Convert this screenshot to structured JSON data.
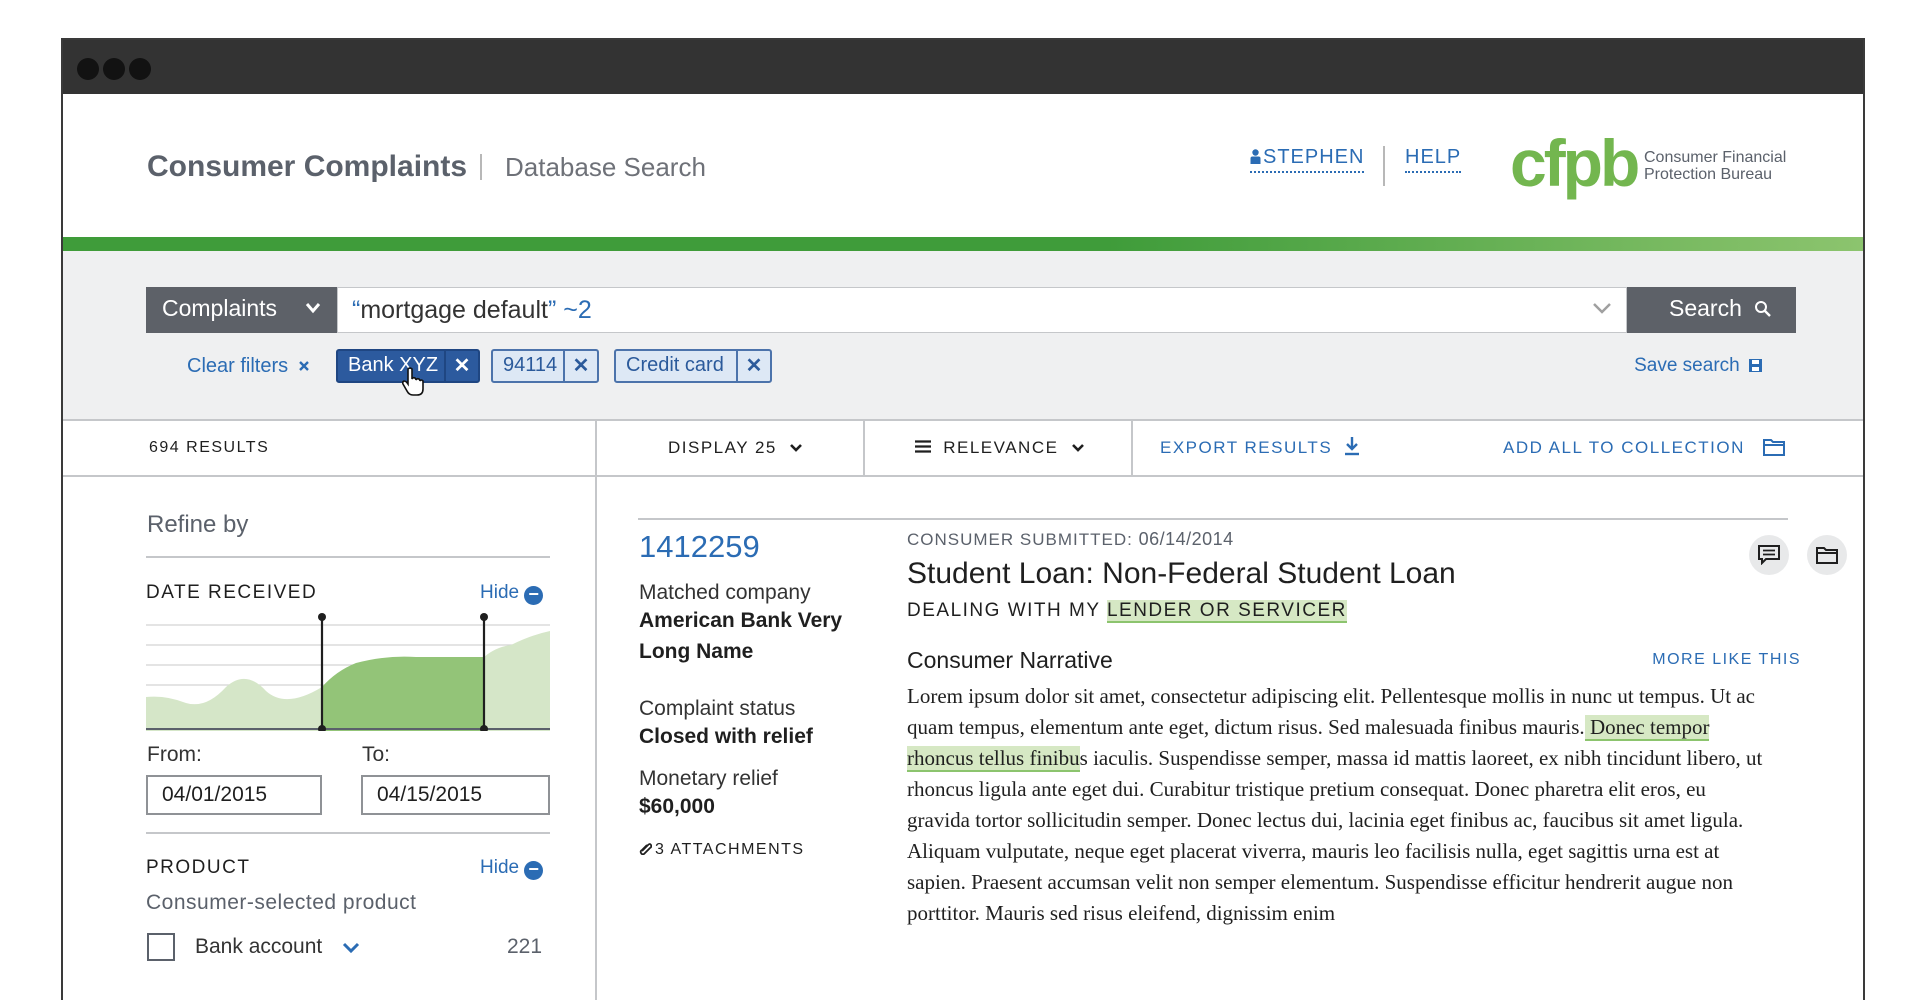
{
  "header": {
    "title": "Consumer Complaints",
    "subtitle": "Database Search",
    "user_label": "STEPHEN",
    "help_label": "HELP",
    "logo_mark": "cfpb",
    "logo_line1": "Consumer Financial",
    "logo_line2": "Protection Bureau"
  },
  "search": {
    "type_label": "Complaints",
    "query_quoted": "“mortgage default”",
    "query_suffix": " ~2",
    "button_label": "Search",
    "clear_filters_label": "Clear filters",
    "filters": [
      "Bank XYZ",
      "94114",
      "Credit card"
    ],
    "save_search_label": "Save search"
  },
  "results_bar": {
    "count_label": "694 RESULTS",
    "display_label": "DISPLAY 25",
    "sort_label": "RELEVANCE",
    "export_label": "EXPORT RESULTS",
    "add_all_label": "ADD ALL TO COLLECTION"
  },
  "refine": {
    "title": "Refine by",
    "date_section": {
      "title": "DATE RECEIVED",
      "hide_label": "Hide",
      "from_label": "From:",
      "to_label": "To:",
      "from_value": "04/01/2015",
      "to_value": "04/15/2015"
    },
    "product_section": {
      "title": "PRODUCT",
      "hide_label": "Hide",
      "subtitle": "Consumer-selected product",
      "items": [
        {
          "label": "Bank account",
          "count": "221"
        }
      ]
    }
  },
  "complaint": {
    "id": "1412259",
    "company_label": "Matched company",
    "company_value": "American Bank Very Long Name",
    "status_label": "Complaint status",
    "status_value": "Closed with relief",
    "relief_label": "Monetary relief",
    "relief_value": "$60,000",
    "attachments_label": "3 ATTACHMENTS",
    "submitted_label": "CONSUMER SUBMITTED:",
    "submitted_date": "06/14/2014",
    "title": "Student Loan: Non-Federal Student Loan",
    "issue_prefix": "DEALING WITH MY",
    "issue_highlight": "LENDER OR SERVICER",
    "narrative_title": "Consumer Narrative",
    "more_like_label": "MORE LIKE THIS",
    "narrative_before": "Lorem ipsum dolor sit amet, consectetur adipiscing elit. Pellentesque mollis in nunc ut tempus. Ut ac quam tempus, elementum ante eget, dictum risus. Sed malesuada finibus mauris.",
    "narrative_highlight": " Donec tempor rhoncus tellus finibu",
    "narrative_after": "s iaculis. Suspendisse semper, massa id mattis laoreet, ex nibh tincidunt libero, ut rhoncus ligula ante eget dui. Curabitur tristique pretium consequat. Donec pharetra elit eros, eu gravida tortor sollicitudin semper. Donec lectus dui, lacinia eget finibus ac, faucibus sit amet ligula. Aliquam vulputate, neque eget placerat viverra, mauris leo facilisis nulla, eget sagittis urna est at sapien. Praesent accumsan velit non semper elementum. Suspendisse efficitur hendrerit augue non porttitor. Mauris sed risus eleifend, dignissim enim"
  },
  "colors": {
    "accent_blue": "#2b6cb4",
    "cfpb_green": "#73b64f",
    "highlight_green": "#d6e8c4",
    "dark_gray": "#5d6168"
  },
  "icons": [
    "user-icon",
    "chevron-down-icon",
    "search-icon",
    "close-icon",
    "save-icon",
    "hamburger-icon",
    "download-icon",
    "folder-icon",
    "minus-circle-icon",
    "paperclip-icon",
    "comment-icon",
    "hand-cursor-icon"
  ]
}
